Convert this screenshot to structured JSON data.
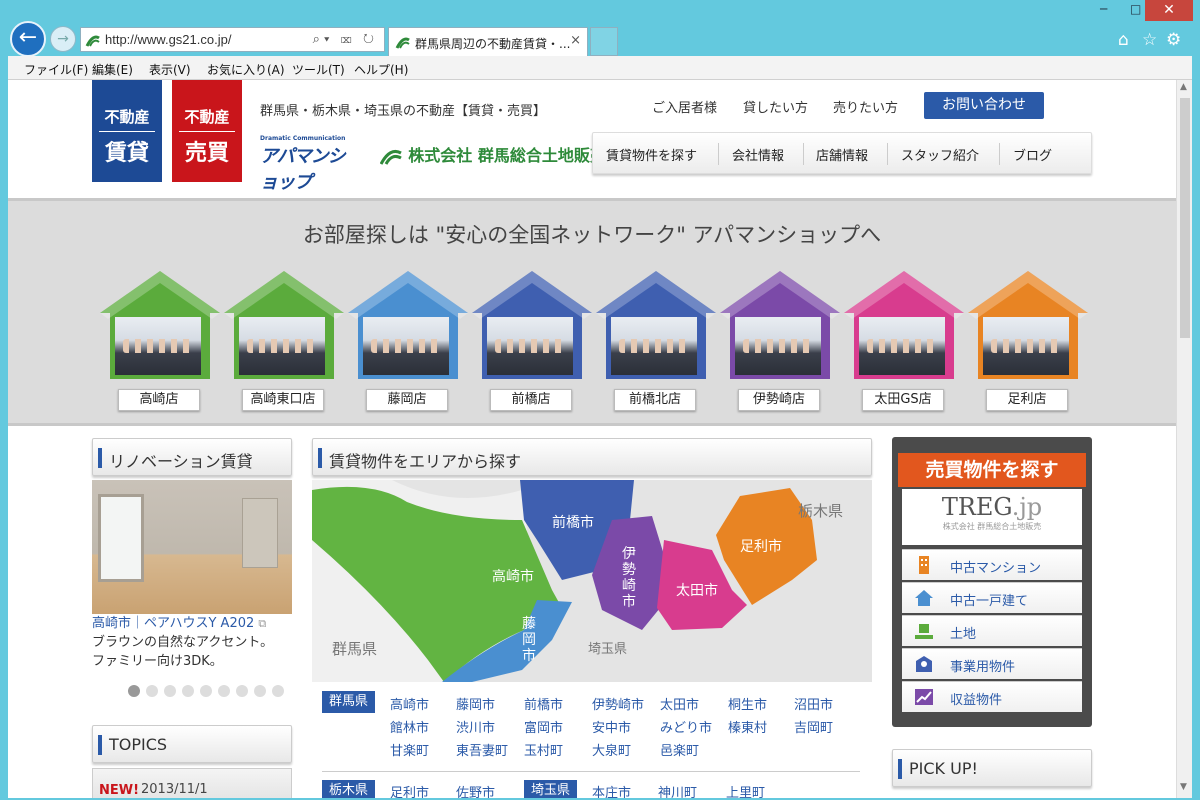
{
  "browser": {
    "url": "http://www.gs21.co.jp/",
    "tab_title": "群馬県周辺の不動産賃貸・...",
    "tab_close": "×",
    "window_controls": {
      "minimize": "─",
      "maximize": "□",
      "close": "✕"
    },
    "tools_icons": [
      "home-icon",
      "star-icon",
      "gear-icon"
    ],
    "menu": [
      "ファイル(F)",
      "編集(E)",
      "表示(V)",
      "お気に入り(A)",
      "ツール(T)",
      "ヘルプ(H)"
    ]
  },
  "header": {
    "badge_rent": {
      "top": "不動産",
      "bottom": "賃貸"
    },
    "badge_sale": {
      "top": "不動産",
      "bottom": "売買"
    },
    "tagline": "群馬県・栃木県・埼玉県の不動産【賃貸・売買】",
    "top_links": [
      "ご入居者様",
      "貸したい方",
      "売りたい方"
    ],
    "contact_button": "お問い合わせ",
    "logo_apaman_small": "Dramatic Communication",
    "logo_apaman": "アパマンショップ",
    "logo_gunma": "株式会社 群馬総合土地販売",
    "global_nav": [
      "賃貸物件を探す",
      "会社情報",
      "店舗情報",
      "スタッフ紹介",
      "ブログ"
    ]
  },
  "stores": {
    "heading": "お部屋探しは \"安心の全国ネットワーク\" アパマンショップへ",
    "items": [
      {
        "name": "高崎店",
        "color": "#5bab3c"
      },
      {
        "name": "高崎東口店",
        "color": "#5bab3c"
      },
      {
        "name": "藤岡店",
        "color": "#4a8fd0"
      },
      {
        "name": "前橋店",
        "color": "#3f5fb0"
      },
      {
        "name": "前橋北店",
        "color": "#3f5fb0"
      },
      {
        "name": "伊勢崎店",
        "color": "#7b4aa8"
      },
      {
        "name": "太田GS店",
        "color": "#d83c8e"
      },
      {
        "name": "足利店",
        "color": "#e88423"
      }
    ]
  },
  "renovation": {
    "heading": "リノベーション賃貸",
    "link": "高崎市｜ペアハウスY A202",
    "desc1": "ブラウンの自然なアクセント。",
    "desc2": "ファミリー向け3DK。",
    "dots_total": 9,
    "dots_active": 1
  },
  "topics": {
    "heading": "TOPICS",
    "first_badge": "NEW!",
    "first_date": "2013/11/1"
  },
  "area_search": {
    "heading": "賃貸物件をエリアから探す",
    "map_labels": {
      "maebashi": "前橋市",
      "takasaki": "高崎市",
      "isesaki": "伊勢崎市",
      "ota": "太田市",
      "ashikaga": "足利市",
      "fujioka": "藤岡市",
      "tochigi": "栃木県",
      "gunma": "群馬県",
      "saitama": "埼玉県"
    },
    "gunma_tag": "群馬県",
    "gunma_cities": [
      [
        "高崎市",
        "藤岡市",
        "前橋市",
        "伊勢崎市",
        "太田市",
        "桐生市",
        "沼田市"
      ],
      [
        "館林市",
        "渋川市",
        "富岡市",
        "安中市",
        "みどり市",
        "榛東村",
        "吉岡町"
      ],
      [
        "甘楽町",
        "東吾妻町",
        "玉村町",
        "大泉町",
        "邑楽町"
      ]
    ],
    "tochigi_tag": "栃木県",
    "tochigi_cities": [
      "足利市",
      "佐野市"
    ],
    "saitama_tag": "埼玉県",
    "saitama_cities": [
      "本庄市",
      "神川町",
      "上里町"
    ]
  },
  "sale_box": {
    "title": "売買物件を探す",
    "logo": "TREG",
    "logo_suffix": ".jp",
    "logo_sub": "株式会社 群馬総合土地販売",
    "items": [
      {
        "label": "中古マンション",
        "icon": "building-icon"
      },
      {
        "label": "中古一戸建て",
        "icon": "house-icon"
      },
      {
        "label": "土地",
        "icon": "land-icon"
      },
      {
        "label": "事業用物件",
        "icon": "office-icon"
      },
      {
        "label": "収益物件",
        "icon": "chart-icon"
      }
    ]
  },
  "pickup": {
    "heading": "PICK UP!"
  }
}
